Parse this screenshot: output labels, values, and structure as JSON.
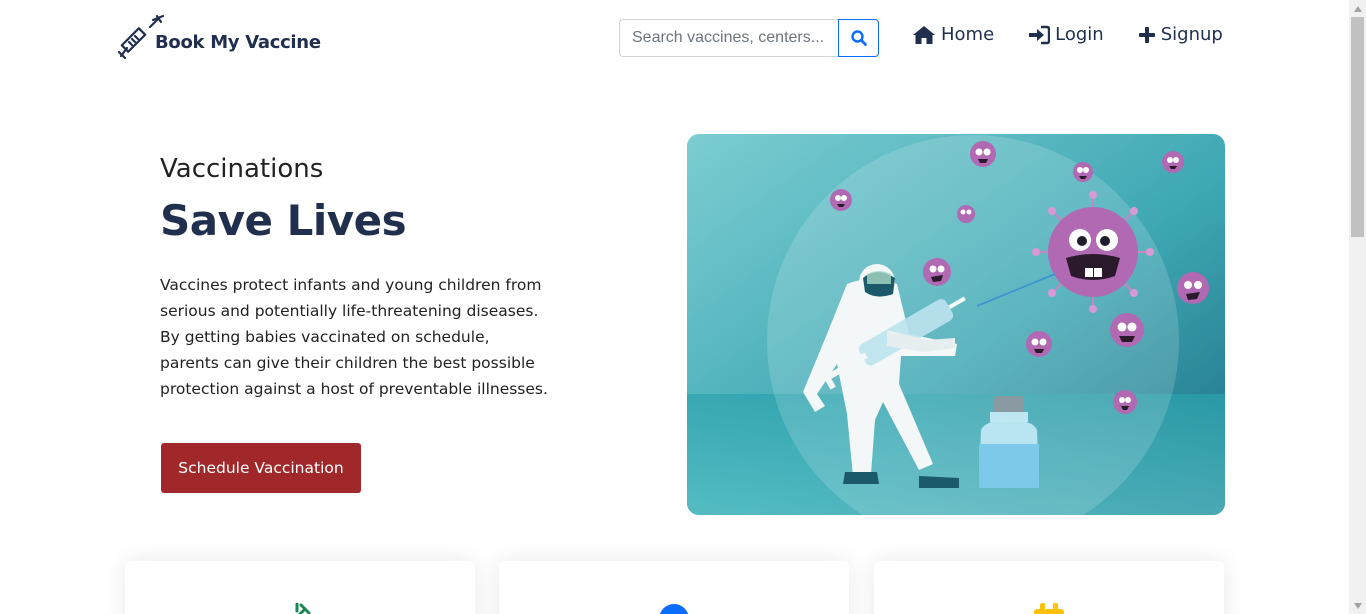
{
  "brand": {
    "name": "Book My Vaccine",
    "icon": "syringe-icon"
  },
  "search": {
    "placeholder": "Search vaccines, centers...",
    "button_icon": "search-icon"
  },
  "nav": {
    "items": [
      {
        "label": "Home",
        "icon": "home-icon"
      },
      {
        "label": "Login",
        "icon": "login-icon"
      },
      {
        "label": "Signup",
        "icon": "plus-icon"
      }
    ]
  },
  "hero": {
    "subtitle": "Vaccinations",
    "title": "Save Lives",
    "body": "Vaccines protect infants and young children from serious and potentially life-threatening diseases. By getting babies vaccinated on schedule, parents can give their children the best possible protection against a host of preventable illnesses.",
    "cta_label": "Schedule Vaccination",
    "image": "doctor-fighting-virus-illustration"
  },
  "feature_cards": [
    {
      "icon": "syringe-icon",
      "color": "#198754"
    },
    {
      "icon": "info-circle-icon",
      "color": "#0d6efd"
    },
    {
      "icon": "calendar-icon",
      "color": "#ffc107"
    }
  ],
  "colors": {
    "brand_navy": "#1f2f4d",
    "cta_red": "#a1282a",
    "search_accent": "#0d6efd",
    "hero_teal": "#4fb3bf"
  }
}
